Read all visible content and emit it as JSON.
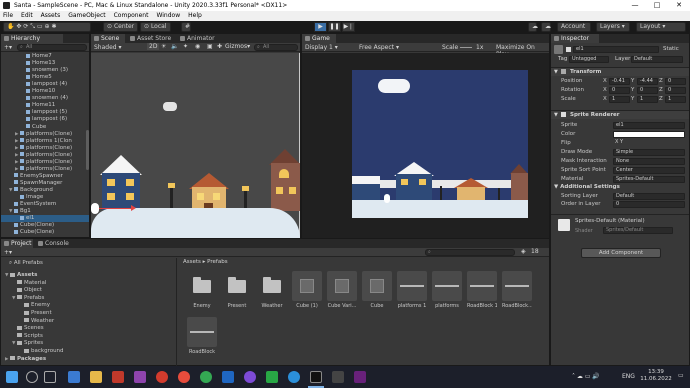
{
  "window": {
    "title": "Santa - SampleScene - PC, Mac & Linux Standalone - Unity 2020.3.33f1 Personal* <DX11>",
    "controls": [
      "—",
      "□",
      "✕"
    ]
  },
  "menu": [
    "File",
    "Edit",
    "Assets",
    "GameObject",
    "Component",
    "Window",
    "Help"
  ],
  "toolbar": {
    "pivot": "Center",
    "space": "Local",
    "account": "Account",
    "layers": "Layers",
    "layout": "Layout"
  },
  "hierarchy": {
    "tab": "Hierarchy",
    "search_placeholder": "All",
    "items": [
      {
        "label": "Home7",
        "indent": 3,
        "arrow": ""
      },
      {
        "label": "Home13",
        "indent": 3,
        "arrow": ""
      },
      {
        "label": "snowmen (3)",
        "indent": 3,
        "arrow": ""
      },
      {
        "label": "Home5",
        "indent": 3,
        "arrow": ""
      },
      {
        "label": "lamppost (4)",
        "indent": 3,
        "arrow": ""
      },
      {
        "label": "Home10",
        "indent": 3,
        "arrow": ""
      },
      {
        "label": "snowmen (4)",
        "indent": 3,
        "arrow": ""
      },
      {
        "label": "Home11",
        "indent": 3,
        "arrow": ""
      },
      {
        "label": "lamppost (5)",
        "indent": 3,
        "arrow": ""
      },
      {
        "label": "lamppost (6)",
        "indent": 3,
        "arrow": ""
      },
      {
        "label": "Cube",
        "indent": 3,
        "arrow": ""
      },
      {
        "label": "platforms(Clone)",
        "indent": 2,
        "arrow": "▶"
      },
      {
        "label": "platforms 1(Clon",
        "indent": 2,
        "arrow": "▶"
      },
      {
        "label": "platforms(Clone)",
        "indent": 2,
        "arrow": "▶"
      },
      {
        "label": "platforms(Clone)",
        "indent": 2,
        "arrow": "▶"
      },
      {
        "label": "platforms(Clone)",
        "indent": 2,
        "arrow": "▶"
      },
      {
        "label": "platforms(Clone)",
        "indent": 2,
        "arrow": "▶"
      },
      {
        "label": "EnemySpawner",
        "indent": 1,
        "arrow": ""
      },
      {
        "label": "SpawnManager",
        "indent": 1,
        "arrow": ""
      },
      {
        "label": "Background",
        "indent": 1,
        "arrow": "▼"
      },
      {
        "label": "Image",
        "indent": 2,
        "arrow": ""
      },
      {
        "label": "EventSystem",
        "indent": 1,
        "arrow": ""
      },
      {
        "label": "Bg1",
        "indent": 1,
        "arrow": "▼"
      },
      {
        "label": "el1",
        "indent": 2,
        "arrow": "",
        "selected": true
      },
      {
        "label": "Cube(Clone)",
        "indent": 1,
        "arrow": ""
      },
      {
        "label": "Cube(Clone)",
        "indent": 1,
        "arrow": ""
      }
    ]
  },
  "scene": {
    "tabs": [
      "Scene",
      "Asset Store",
      "Animator"
    ],
    "shading": "Shaded",
    "mode": "2D",
    "gizmos": "Gizmos",
    "search_placeholder": "All"
  },
  "game": {
    "tab": "Game",
    "display": "Display 1",
    "aspect": "Free Aspect",
    "scale_label": "Scale",
    "scale_value": "1x",
    "maximize": "Maximize On Play",
    "sky_color": "#2b3b6e"
  },
  "inspector": {
    "tab": "Inspector",
    "object_name": "el1",
    "static_label": "Static",
    "tag_label": "Tag",
    "tag_value": "Untagged",
    "layer_label": "Layer",
    "layer_value": "Default",
    "transform": {
      "title": "Transform",
      "rows": [
        {
          "label": "Position",
          "x": "-0.41",
          "y": "-4.44",
          "z": "0"
        },
        {
          "label": "Rotation",
          "x": "0",
          "y": "0",
          "z": "0"
        },
        {
          "label": "Scale",
          "x": "1",
          "y": "1",
          "z": "1"
        }
      ]
    },
    "sprite_renderer": {
      "title": "Sprite Renderer",
      "rows": [
        {
          "label": "Sprite",
          "value": "el1"
        },
        {
          "label": "Color",
          "value": ""
        },
        {
          "label": "Flip",
          "value": "X  Y"
        },
        {
          "label": "Draw Mode",
          "value": "Simple"
        },
        {
          "label": "Mask Interaction",
          "value": "None"
        },
        {
          "label": "Sprite Sort Point",
          "value": "Center"
        },
        {
          "label": "Material",
          "value": "Sprites-Default"
        }
      ],
      "additional": "Additional Settings",
      "sorting_layer_label": "Sorting Layer",
      "sorting_layer_value": "Default",
      "order_label": "Order in Layer",
      "order_value": "0"
    },
    "material": {
      "name": "Sprites-Default (Material)",
      "shader_label": "Shader",
      "shader_value": "Sprites/Default"
    },
    "add_component": "Add Component"
  },
  "project": {
    "tabs": [
      "Project",
      "Console"
    ],
    "favorites": "All Prefabs",
    "tree": [
      {
        "label": "Assets",
        "indent": 0,
        "arrow": "▼",
        "bold": true
      },
      {
        "label": "Material",
        "indent": 1,
        "arrow": ""
      },
      {
        "label": "Object",
        "indent": 1,
        "arrow": ""
      },
      {
        "label": "Prefabs",
        "indent": 1,
        "arrow": "▼"
      },
      {
        "label": "Enemy",
        "indent": 2,
        "arrow": ""
      },
      {
        "label": "Present",
        "indent": 2,
        "arrow": ""
      },
      {
        "label": "Weather",
        "indent": 2,
        "arrow": ""
      },
      {
        "label": "Scenes",
        "indent": 1,
        "arrow": ""
      },
      {
        "label": "Scripts",
        "indent": 1,
        "arrow": ""
      },
      {
        "label": "Sprites",
        "indent": 1,
        "arrow": "▼"
      },
      {
        "label": "background",
        "indent": 2,
        "arrow": ""
      },
      {
        "label": "Packages",
        "indent": 0,
        "arrow": "▶",
        "bold": true
      }
    ],
    "breadcrumb": [
      "Assets",
      "Prefabs"
    ],
    "asset_count": "18",
    "assets": [
      {
        "label": "Enemy",
        "kind": "folder"
      },
      {
        "label": "Present",
        "kind": "folder"
      },
      {
        "label": "Weather",
        "kind": "folder"
      },
      {
        "label": "Cube (1)",
        "kind": "cube"
      },
      {
        "label": "Cube Vari...",
        "kind": "cube"
      },
      {
        "label": "Cube",
        "kind": "cube"
      },
      {
        "label": "platforms 1",
        "kind": "bar"
      },
      {
        "label": "platforms",
        "kind": "bar"
      },
      {
        "label": "RoadBlock 1",
        "kind": "bar"
      },
      {
        "label": "RoadBlock...",
        "kind": "bar"
      },
      {
        "label": "RoadBlock",
        "kind": "bar"
      }
    ]
  },
  "taskbar": {
    "lang": "ENG",
    "time": "13:39",
    "date": "11.06.2022"
  }
}
